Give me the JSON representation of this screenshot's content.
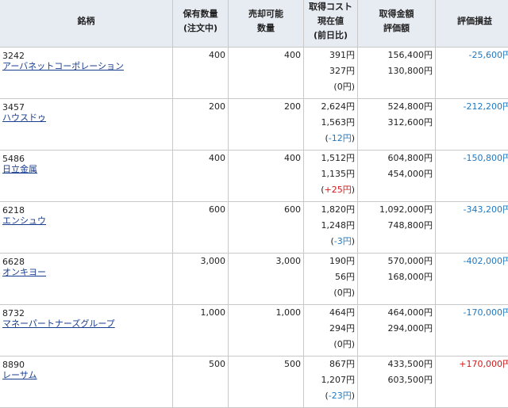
{
  "header": {
    "col_name": "銘柄",
    "col_holding_1": "保有数量",
    "col_holding_2": "(注文中)",
    "col_sellable_1": "売却可能",
    "col_sellable_2": "数量",
    "col_price_1": "取得コスト",
    "col_price_2": "現在値",
    "col_price_3": "(前日比)",
    "col_amount_1": "取得金額",
    "col_amount_2": "評価額",
    "col_pl": "評価損益"
  },
  "rows": [
    {
      "code": "3242",
      "name": "アーバネットコーポレーション",
      "qty": "400",
      "sellable": "400",
      "cost": "391円",
      "current": "327円",
      "change_open": "(",
      "change_val": "0円",
      "change_close": ")",
      "change_sign": "zero",
      "acq": "156,400円",
      "val": "130,800円",
      "pl": "-25,600円",
      "pl_sign": "neg"
    },
    {
      "code": "3457",
      "name": "ハウスドゥ",
      "qty": "200",
      "sellable": "200",
      "cost": "2,624円",
      "current": "1,563円",
      "change_open": "(",
      "change_val": "-12円",
      "change_close": ")",
      "change_sign": "neg",
      "acq": "524,800円",
      "val": "312,600円",
      "pl": "-212,200円",
      "pl_sign": "neg"
    },
    {
      "code": "5486",
      "name": "日立金属",
      "qty": "400",
      "sellable": "400",
      "cost": "1,512円",
      "current": "1,135円",
      "change_open": "(",
      "change_val": "+25円",
      "change_close": ")",
      "change_sign": "pos",
      "acq": "604,800円",
      "val": "454,000円",
      "pl": "-150,800円",
      "pl_sign": "neg"
    },
    {
      "code": "6218",
      "name": "エンシュウ",
      "qty": "600",
      "sellable": "600",
      "cost": "1,820円",
      "current": "1,248円",
      "change_open": "(",
      "change_val": "-3円",
      "change_close": ")",
      "change_sign": "neg",
      "acq": "1,092,000円",
      "val": "748,800円",
      "pl": "-343,200円",
      "pl_sign": "neg"
    },
    {
      "code": "6628",
      "name": "オンキヨー",
      "qty": "3,000",
      "sellable": "3,000",
      "cost": "190円",
      "current": "56円",
      "change_open": "(",
      "change_val": "0円",
      "change_close": ")",
      "change_sign": "zero",
      "acq": "570,000円",
      "val": "168,000円",
      "pl": "-402,000円",
      "pl_sign": "neg"
    },
    {
      "code": "8732",
      "name": "マネーパートナーズグループ",
      "qty": "1,000",
      "sellable": "1,000",
      "cost": "464円",
      "current": "294円",
      "change_open": "(",
      "change_val": "0円",
      "change_close": ")",
      "change_sign": "zero",
      "acq": "464,000円",
      "val": "294,000円",
      "pl": "-170,000円",
      "pl_sign": "neg"
    },
    {
      "code": "8890",
      "name": "レーサム",
      "qty": "500",
      "sellable": "500",
      "cost": "867円",
      "current": "1,207円",
      "change_open": "(",
      "change_val": "-23円",
      "change_close": ")",
      "change_sign": "neg",
      "acq": "433,500円",
      "val": "603,500円",
      "pl": "+170,000円",
      "pl_sign": "pos"
    }
  ]
}
